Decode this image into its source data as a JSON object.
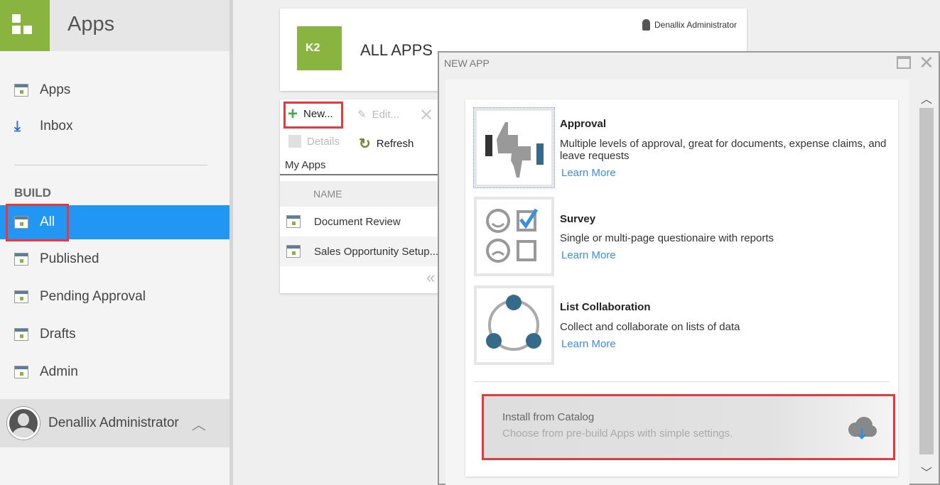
{
  "sidebar": {
    "title": "Apps",
    "top_items": [
      {
        "label": "Apps"
      },
      {
        "label": "Inbox"
      }
    ],
    "section": "BUILD",
    "build_items": [
      {
        "label": "All",
        "selected": true
      },
      {
        "label": "Published"
      },
      {
        "label": "Pending Approval"
      },
      {
        "label": "Drafts"
      },
      {
        "label": "Admin"
      }
    ],
    "user": "Denallix Administrator"
  },
  "header": {
    "logo": "K2",
    "title": "ALL APPS",
    "user": "Denallix Administrator"
  },
  "toolbar": {
    "new": "New...",
    "edit": "Edit...",
    "details": "Details",
    "refresh": "Refresh"
  },
  "list": {
    "title": "My Apps",
    "column": "NAME",
    "rows": [
      "Document Review",
      "Sales Opportunity Setup..."
    ]
  },
  "dialog": {
    "title": "NEW APP",
    "templates": [
      {
        "title": "Approval",
        "desc": "Multiple levels of approval, great for documents, expense claims, and leave requests",
        "link": "Learn More"
      },
      {
        "title": "Survey",
        "desc": "Single or multi-page questionaire with reports",
        "link": "Learn More"
      },
      {
        "title": "List Collaboration",
        "desc": "Collect and collaborate on lists of data",
        "link": "Learn More"
      }
    ],
    "catalog": {
      "title": "Install from Catalog",
      "subtitle": "Choose from pre-build Apps with simple settings."
    }
  },
  "colors": {
    "brand": "#8ab440",
    "selected": "#2196f3",
    "highlight": "#e8383d",
    "link": "#3b8fdf"
  }
}
